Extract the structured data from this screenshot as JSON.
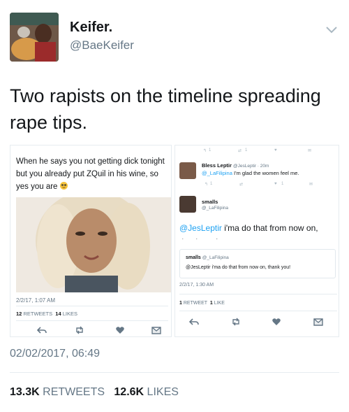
{
  "author": {
    "name": "Keifer.",
    "handle": "@BaeKeifer"
  },
  "tweet": {
    "text": "Two rapists on the timeline spreading rape tips.",
    "timestamp": "02/02/2017, 06:49",
    "retweets_count": "13.3K",
    "retweets_label": "RETWEETS",
    "likes_count": "12.6K",
    "likes_label": "LIKES"
  },
  "left_screenshot": {
    "text": "When he says you not getting dick tonight but you already put ZQuil in his wine, so yes you are",
    "date": "2/2/17, 1:07 AM",
    "retweets_count": "12",
    "retweets_label": "RETWEETS",
    "likes_count": "14",
    "likes_label": "LIKES"
  },
  "right_screenshot": {
    "top_actions": {
      "reply_count": "1",
      "retweet_count": "1"
    },
    "reply": {
      "name": "Bless Leptir",
      "meta": "@JesLeptir · 20m",
      "mention": "@_LaFilipina",
      "text": "I'm glad the women feel me.",
      "reply_count": "1",
      "like_count": "1"
    },
    "main": {
      "name": "smalls",
      "handle": "@_LaFilipina",
      "mention": "@JesLeptir",
      "text": "i'ma do that from now on,",
      "text_cut": "thank you!"
    },
    "quote": {
      "name": "smalls",
      "handle": "@_LaFilipina",
      "text": "@JesLeptir i'ma do that from now on, thank you!"
    },
    "date": "2/2/17, 1:30 AM",
    "retweets_count": "1",
    "retweets_label": "RETWEET",
    "likes_count": "1",
    "likes_label": "LIKE"
  },
  "colors": {
    "accent": "#1da1f2",
    "muted": "#657786",
    "text": "#14171a",
    "border": "#e6ecf0"
  }
}
